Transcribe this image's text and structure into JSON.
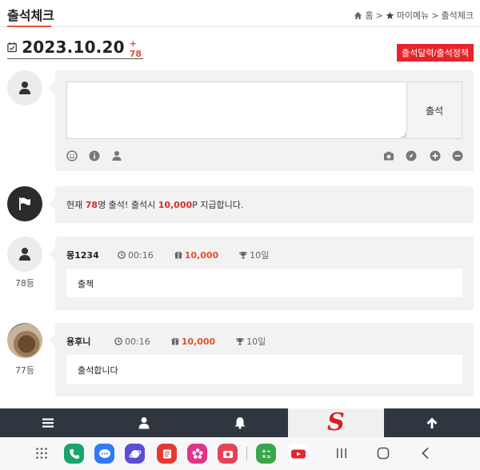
{
  "header": {
    "title": "출석체크",
    "breadcrumb": {
      "home": "홈",
      "sep1": ">",
      "menu": "마이메뉴",
      "sep2": ">",
      "current": "출석체크"
    }
  },
  "date_bar": {
    "date": "2023.10.20",
    "count": "+ 78",
    "calendar_button": "출석달력/출석정책"
  },
  "form": {
    "textarea_value": "",
    "submit_label": "출석"
  },
  "notice": {
    "prefix": "현재 ",
    "count": "78",
    "middle": "명 출석! 출석시 ",
    "points": "10,000",
    "suffix": "P 지급합니다."
  },
  "entries": [
    {
      "rank": "78등",
      "user": "몽1234",
      "time": "00:16",
      "points": "10,000",
      "streak": "10일",
      "message": "출첵"
    },
    {
      "rank": "77등",
      "user": "용후니",
      "time": "00:16",
      "points": "10,000",
      "streak": "10일",
      "message": "출석합니다"
    }
  ],
  "bottom_bar": {
    "logo": "S"
  },
  "colors": {
    "accent": "#e0522f",
    "red_button": "#e8232a",
    "bottom_bar": "#2f3640",
    "panel": "#f2f2f2"
  },
  "icons": [
    "home-icon",
    "star-icon",
    "calendar-check-icon",
    "user-icon",
    "smile-icon",
    "info-icon",
    "camera-icon",
    "compass-icon",
    "plus-circle-icon",
    "minus-circle-icon",
    "flag-icon",
    "clock-icon",
    "gift-icon",
    "trophy-icon",
    "menu-icon",
    "bell-icon",
    "arrow-up-icon"
  ]
}
